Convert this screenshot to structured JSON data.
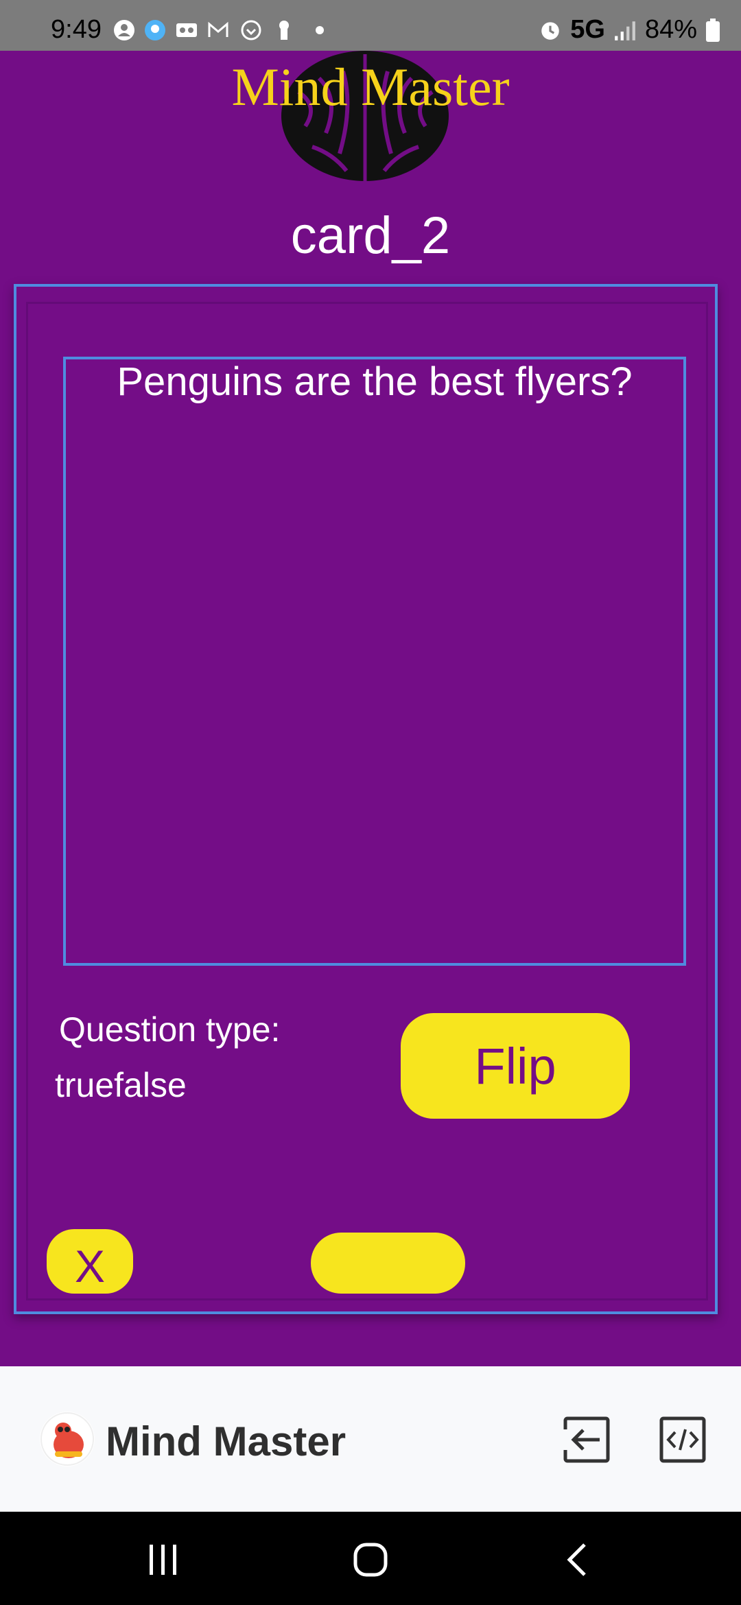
{
  "status_bar": {
    "time": "9:49",
    "network": "5G",
    "battery": "84%"
  },
  "header": {
    "app_title": "Mind Master",
    "card_name": "card_2"
  },
  "card": {
    "question": "Penguins are the best flyers?",
    "question_type_label": "Question type:",
    "question_type_value": "truefalse",
    "flip_label": "Flip",
    "close_label": "X",
    "next_label": ""
  },
  "app_bar": {
    "title": "Mind Master"
  },
  "colors": {
    "background": "#730D86",
    "accent_yellow": "#F7E51E",
    "title_yellow": "#F6D21B",
    "border_blue": "#4F8CE0"
  },
  "icons": [
    "brain-icon",
    "exit-icon",
    "code-icon",
    "recents-icon",
    "home-icon",
    "back-icon"
  ]
}
